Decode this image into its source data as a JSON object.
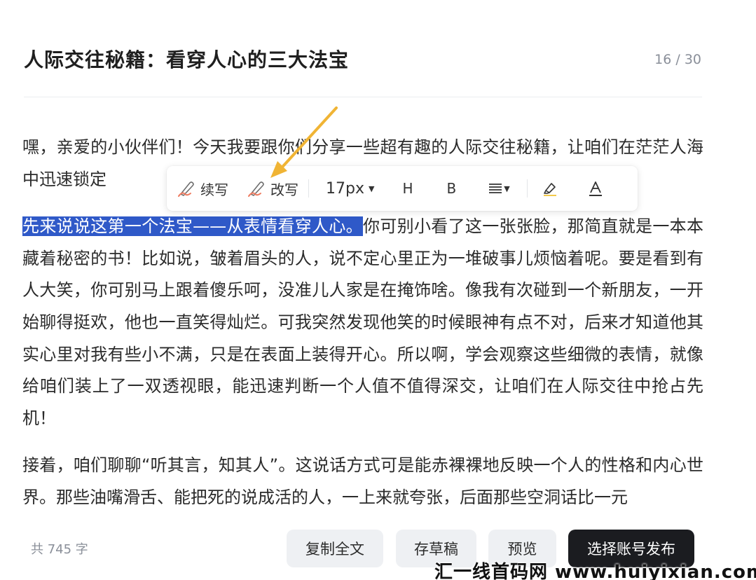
{
  "header": {
    "title": "人际交往秘籍：看穿人心的三大法宝",
    "counter": "16 / 30"
  },
  "content": {
    "p1": "嘿，亲爱的小伙伴们！今天我要跟你们分享一些超有趣的人际交往秘籍，让咱们在茫茫人海中迅速锁定",
    "p2_selected": "先来说说这第一个法宝——从表情看穿人心。",
    "p2_rest": "你可别小看了这一张张脸，那简直就是一本本藏着秘密的书！比如说，皱着眉头的人，说不定心里正为一堆破事儿烦恼着呢。要是看到有人大笑，你可别马上跟着傻乐呵，没准儿人家是在掩饰啥。像我有次碰到一个新朋友，一开始聊得挺欢，他也一直笑得灿烂。可我突然发现他笑的时候眼神有点不对，后来才知道他其实心里对我有些小不满，只是在表面上装得开心。所以啊，学会观察这些细微的表情，就像给咱们装上了一双透视眼，能迅速判断一个人值不值得深交，让咱们在人际交往中抢占先机！",
    "p3": "接着，咱们聊聊“听其言，知其人”。这说话方式可是能赤裸裸地反映一个人的性格和内心世界。那些油嘴滑舌、能把死的说成活的人，一上来就夸张，后面那些空洞话比一元"
  },
  "toolbar": {
    "continue_label": "续写",
    "rewrite_label": "改写",
    "font_size": "17px",
    "heading_label": "H",
    "bold_label": "B",
    "icons": {
      "continue": "pen-icon",
      "rewrite": "pen-icon",
      "align": "align-icon",
      "highlight": "highlighter-icon",
      "font_color": "font-color-icon"
    }
  },
  "footer": {
    "word_count": "共 745 字",
    "copy_all": "复制全文",
    "save_draft": "存草稿",
    "preview": "预览",
    "publish": "选择账号发布"
  },
  "watermark": "汇一线首码网 www.huiyixian.com",
  "colors": {
    "selection": "#2f59c8",
    "arrow": "#f0b434",
    "publish_bg": "#1b1c20",
    "pen_accent": "#ee7a5f"
  }
}
